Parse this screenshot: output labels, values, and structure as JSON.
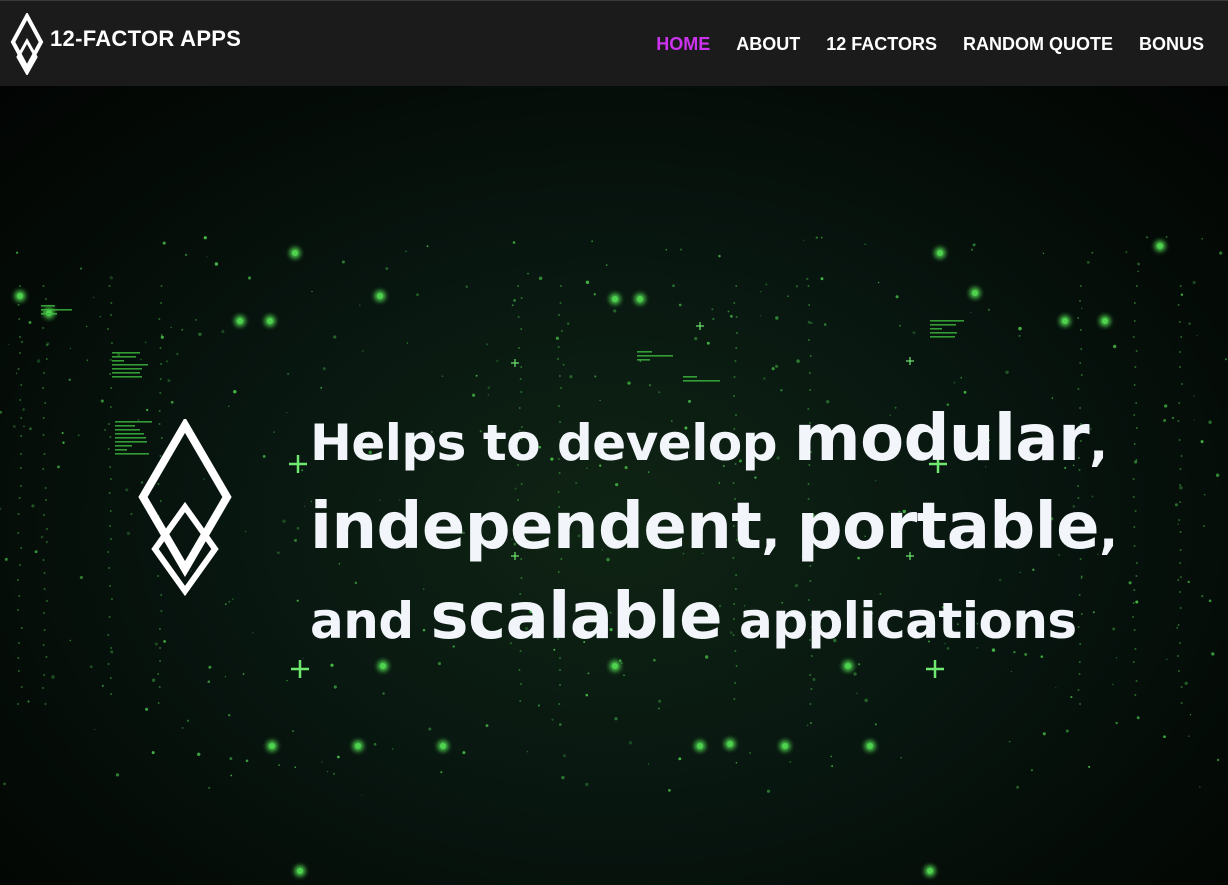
{
  "app": {
    "brand": "12-FACTOR APPS",
    "logo_icon": "diamond-logo-icon"
  },
  "nav": {
    "items": [
      {
        "label": "HOME",
        "active": true
      },
      {
        "label": "ABOUT",
        "active": false
      },
      {
        "label": "12 FACTORS",
        "active": false
      },
      {
        "label": "RANDOM QUOTE",
        "active": false
      },
      {
        "label": "BONUS",
        "active": false
      }
    ],
    "active_color": "#cc33ee"
  },
  "hero": {
    "line1": {
      "a": "Helps to develop ",
      "b": "modular",
      "c": ","
    },
    "line2": {
      "a": "independent",
      "b": ", ",
      "c": "portable",
      "d": ","
    },
    "line3": {
      "a": "and ",
      "b": "scalable",
      "c": " applications"
    },
    "text_color": "#f2f5fa",
    "accent_color": "#4fd34f"
  }
}
